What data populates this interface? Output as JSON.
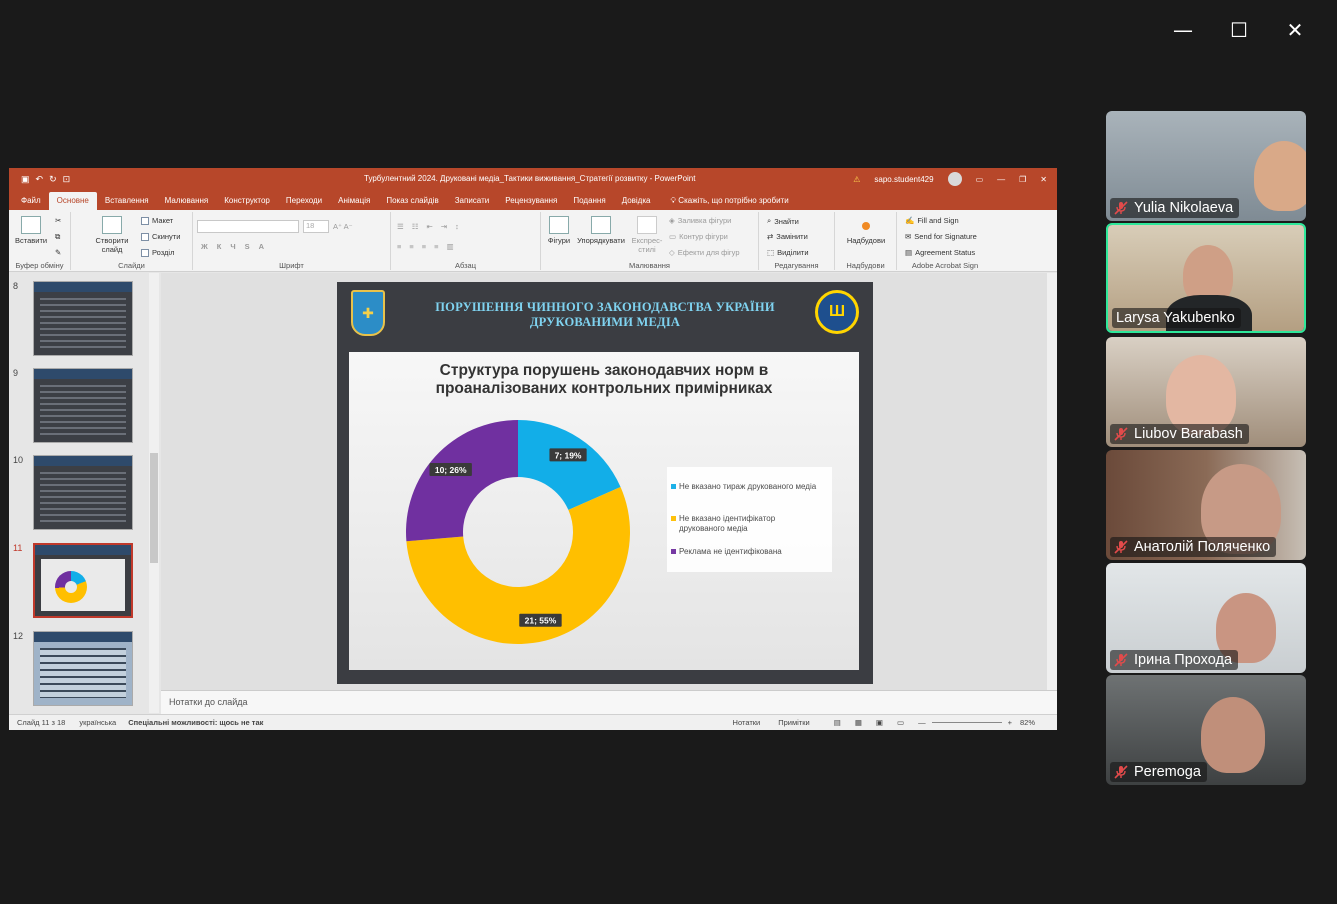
{
  "window_controls": {
    "minimize": "—",
    "maximize": "☐",
    "close": "✕"
  },
  "app": {
    "title": "Турбулентний 2024. Друковані медіа_Тактики виживання_Стратегії розвитку  -  PowerPoint",
    "user": "sapo.student429",
    "qat_icons": [
      "save-icon",
      "undo-icon",
      "redo-icon",
      "present-icon"
    ]
  },
  "tabs": [
    "Файл",
    "Основне",
    "Вставлення",
    "Малювання",
    "Конструктор",
    "Переходи",
    "Анімація",
    "Показ слайдів",
    "Записати",
    "Рецензування",
    "Подання",
    "Довідка"
  ],
  "tell_me": "Скажіть, що потрібно зробити",
  "ribbon": {
    "clipboard": {
      "paste": "Вставити",
      "group": "Буфер обміну"
    },
    "slides": {
      "new_slide": "Створити слайд",
      "layout": "Макет",
      "reset": "Скинути",
      "section": "Розділ",
      "group": "Слайди"
    },
    "font": {
      "size": "18",
      "group": "Шрифт",
      "bold": "Ж",
      "italic": "К",
      "underline": "Ч",
      "strike": "S",
      "font_color": "A"
    },
    "paragraph": {
      "group": "Абзац"
    },
    "drawing": {
      "shapes": "Фігури",
      "arrange": "Упорядкувати",
      "styles": "Експрес-стилі",
      "fill": "Заливка фігури",
      "outline": "Контур фігури",
      "effects": "Ефекти для фігур",
      "group": "Малювання"
    },
    "editing": {
      "find": "Знайти",
      "replace": "Замінити",
      "select": "Виділити",
      "group": "Редагування"
    },
    "addins": {
      "addins": "Надбудови",
      "group": "Надбудови"
    },
    "adobe": {
      "fill_sign": "Fill and Sign",
      "send_sig": "Send for Signature",
      "agreement": "Agreement Status",
      "group": "Adobe Acrobat Sign"
    }
  },
  "thumbnails": [
    {
      "num": "8"
    },
    {
      "num": "9"
    },
    {
      "num": "10"
    },
    {
      "num": "11",
      "active": true
    },
    {
      "num": "12"
    }
  ],
  "slide": {
    "header_title": "ПОРУШЕННЯ ЧИННОГО ЗАКОНОДАВСТВА УКРАЇНИ ДРУКОВАНИМИ МЕДІА"
  },
  "chart_data": {
    "type": "pie",
    "donut": true,
    "title": "Структура порушень законодавчих норм в проаналізованих контрольних примірниках",
    "series": [
      {
        "name": "Не вказано тираж друкованого медіа",
        "value": 7,
        "percent": 19,
        "label": "7; 19%",
        "color": "#12aee8"
      },
      {
        "name": "Не вказано ідентифікатор друкованого медіа",
        "value": 21,
        "percent": 55,
        "label": "21; 55%",
        "color": "#ffbf00"
      },
      {
        "name": "Реклама не ідентифікована",
        "value": 10,
        "percent": 26,
        "label": "10; 26%",
        "color": "#7030a0"
      }
    ],
    "legend_position": "right"
  },
  "notes_placeholder": "Нотатки до слайда",
  "status": {
    "slide_of": "Слайд 11 з 18",
    "language": "українська",
    "accessibility": "Спеціальні можливості: щось не так",
    "notes": "Нотатки",
    "comments": "Примітки",
    "zoom": "82%"
  },
  "participants": [
    {
      "name": "Yulia  Nikolaeva",
      "muted": true,
      "bg": "#8f9aa3"
    },
    {
      "name": "Larysa Yakubenko",
      "muted": false,
      "speaking": true,
      "bg": "#c9b79c"
    },
    {
      "name": "Liubov Barabash",
      "muted": true,
      "bg": "#b8a48c"
    },
    {
      "name": "Анатолій Поляченко",
      "muted": true,
      "bg": "#7a5a48"
    },
    {
      "name": "Ірина Прохода",
      "muted": true,
      "bg": "#cfd5d8"
    },
    {
      "name": "Peremoga",
      "muted": true,
      "bg": "#5c5f60"
    }
  ]
}
